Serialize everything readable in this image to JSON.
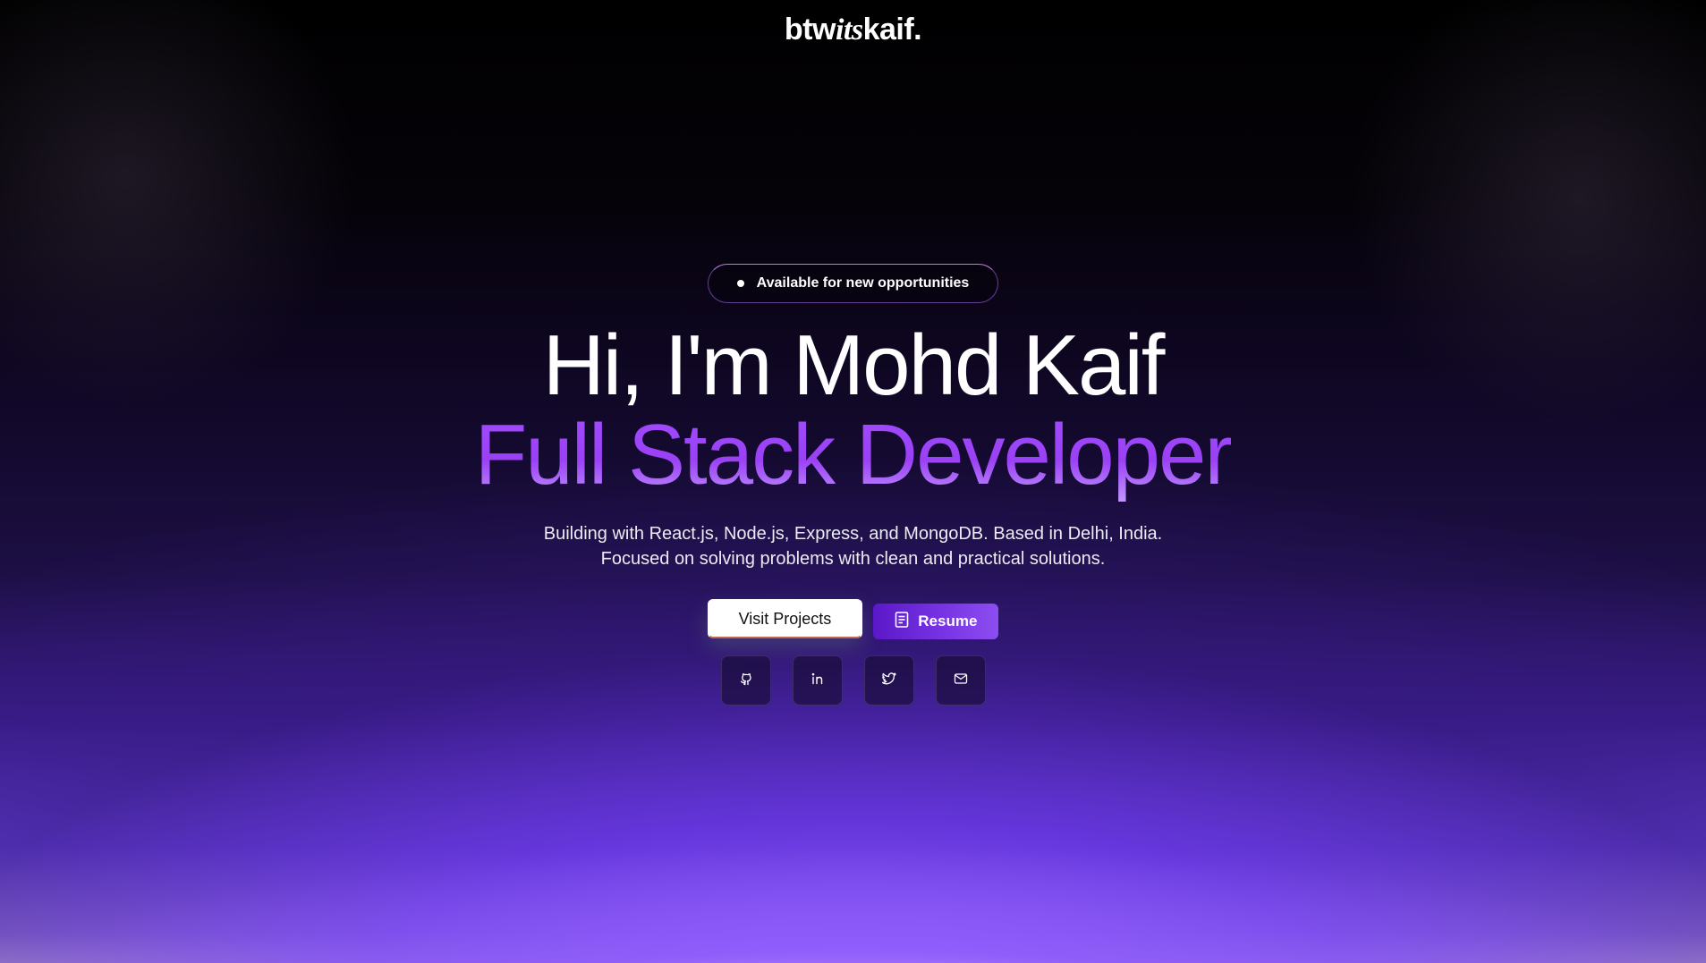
{
  "brand": {
    "prefix": "btw",
    "italic": "its",
    "suffix": "kaif."
  },
  "hero": {
    "badge": "Available for new opportunities",
    "headline": "Hi, I'm Mohd Kaif",
    "subhead": "Full Stack Developer",
    "description_line1": "Building with React.js, Node.js, Express, and MongoDB. Based in Delhi, India.",
    "description_line2": "Focused on solving problems with clean and practical solutions."
  },
  "actions": {
    "projects_label": "Visit Projects",
    "resume_label": "Resume"
  },
  "socials": [
    {
      "icon": "github-icon"
    },
    {
      "icon": "linkedin-icon"
    },
    {
      "icon": "twitter-icon"
    },
    {
      "icon": "mail-icon"
    }
  ],
  "colors": {
    "accent": "#9a40f5",
    "resume_bg": "#6a28d8",
    "background_top": "#000000",
    "background_bottom": "#f3dcff"
  }
}
